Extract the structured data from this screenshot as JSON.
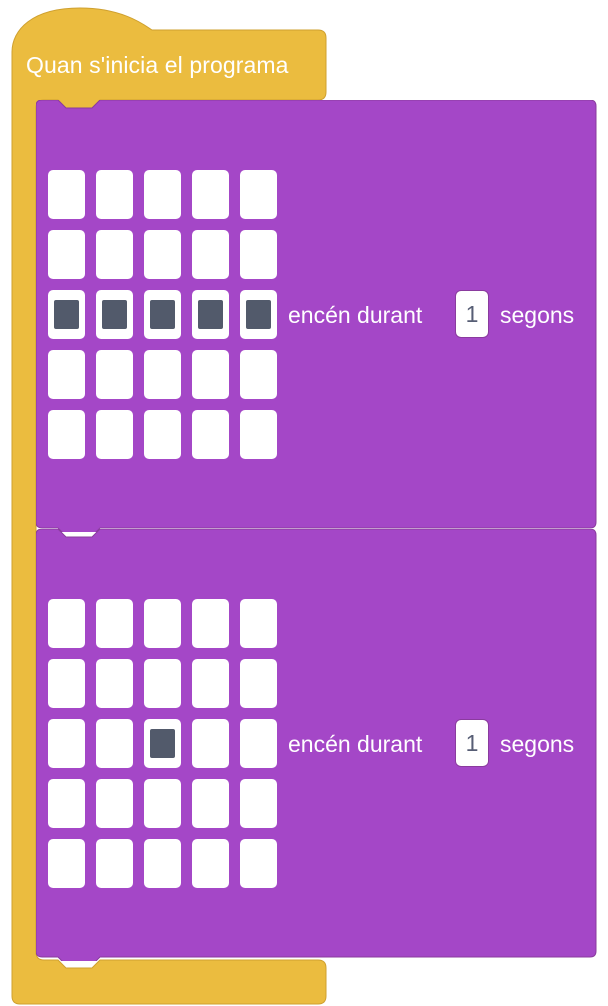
{
  "hat_block": {
    "label": "Quan s'inicia el programa",
    "color": "#ebbc3f"
  },
  "block_color": "#a447c7",
  "blocks": [
    {
      "matrix": [
        [
          0,
          0,
          0,
          0,
          0
        ],
        [
          0,
          0,
          0,
          0,
          0
        ],
        [
          1,
          1,
          1,
          1,
          1
        ],
        [
          0,
          0,
          0,
          0,
          0
        ],
        [
          0,
          0,
          0,
          0,
          0
        ]
      ],
      "label_before": "encén durant",
      "duration": "1",
      "label_after": "segons"
    },
    {
      "matrix": [
        [
          0,
          0,
          0,
          0,
          0
        ],
        [
          0,
          0,
          0,
          0,
          0
        ],
        [
          0,
          0,
          1,
          0,
          0
        ],
        [
          0,
          0,
          0,
          0,
          0
        ],
        [
          0,
          0,
          0,
          0,
          0
        ]
      ],
      "label_before": "encén durant",
      "duration": "1",
      "label_after": "segons"
    }
  ]
}
